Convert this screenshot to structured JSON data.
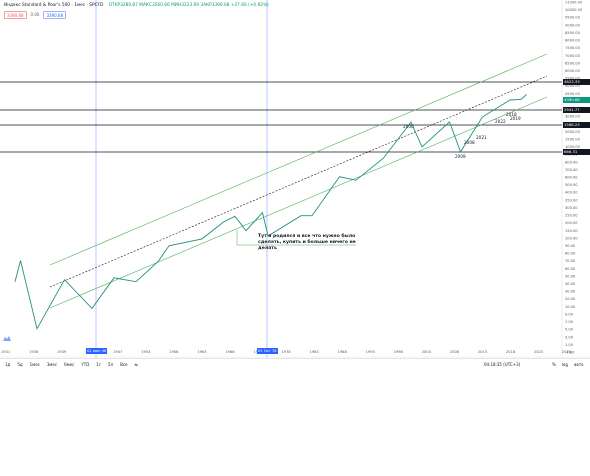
{
  "legend": {
    "title": "Индекс Standard & Poor's 500 · 1мес · SPCFD",
    "ohlc": "OTKP3280.87 МАКС3560.66 МИН3223.69 ЗАКР3390.68 +27.66 (+0.82%)"
  },
  "price_buttons": {
    "sell": "3390.68",
    "mid": "0.00",
    "buy": "3390.68"
  },
  "y_axis": {
    "ticks": [
      "11000.00",
      "10000.00",
      "9500.00",
      "9000.00",
      "8500.00",
      "8000.00",
      "7500.00",
      "7000.00",
      "6500.00",
      "6000.00",
      "5500.00",
      "5000.00",
      "4500.00",
      "4000.00",
      "3500.00",
      "3000.00",
      "2500.00",
      "2000.00",
      "1500.00",
      "1000.00",
      "900.00",
      "800.00",
      "700.00",
      "600.00",
      "500.00",
      "400.00",
      "350.00",
      "300.00",
      "250.00",
      "200.00",
      "150.00",
      "100.00",
      "90.00",
      "80.00",
      "70.00",
      "60.00",
      "50.00",
      "40.00",
      "30.00",
      "20.00",
      "10.00",
      "9.00",
      "7.00",
      "5.00",
      "3.00",
      "1.00",
      "-1.00"
    ],
    "labels": [
      {
        "text": "4823.33",
        "color": "#131722"
      },
      {
        "text": "3390.68",
        "color": "#089981"
      },
      {
        "text": "2941.77",
        "color": "#131722"
      },
      {
        "text": "1568.23",
        "color": "#131722"
      },
      {
        "text": "666.31",
        "color": "#131722"
      }
    ]
  },
  "x_axis": {
    "ticks": [
      "1931",
      "1936",
      "1939",
      "1943",
      "1947",
      "1953",
      "1958",
      "1963",
      "1968",
      "1973",
      "1978",
      "1983",
      "1988",
      "1993",
      "1998",
      "2003",
      "2008",
      "2013",
      "2018",
      "2023",
      "2028"
    ],
    "markers": [
      {
        "text": "01 июн 46"
      },
      {
        "text": "01 Окт 78"
      }
    ]
  },
  "annotations": {
    "note": "Тут я родился и все что нужно было сделать, купить и больше ничего не делать",
    "years": [
      "2000",
      "2008",
      "2009",
      "2018",
      "2021",
      "2022",
      "2019"
    ]
  },
  "period_buttons": [
    "1д",
    "5д",
    "1мес",
    "3мес",
    "6мес",
    "YTD",
    "1г",
    "5л",
    "Все",
    "⇆"
  ],
  "clock": "04:18:35 (UTC+3)",
  "options": [
    "%",
    "log",
    "авто"
  ],
  "colors": {
    "up": "#089981",
    "down": "#ef5350",
    "channel": "#4caf50",
    "accent": "#2962ff",
    "hline": "#131722"
  },
  "chart_data": {
    "type": "line",
    "title": "Индекс Standard & Poor's 500",
    "xlabel": "",
    "ylabel": "",
    "log_scale": true,
    "x": [
      1928,
      1929,
      1932,
      1937,
      1942,
      1946,
      1950,
      1954,
      1956,
      1962,
      1966,
      1968,
      1970,
      1973,
      1974,
      1980,
      1982,
      1987,
      1990,
      1995,
      2000,
      2002,
      2007,
      2009,
      2013,
      2018,
      2020,
      2021
    ],
    "series": [
      {
        "values": [
          17,
          31,
          4.5,
          18,
          8,
          19,
          17,
          30,
          47,
          57,
          93,
          108,
          72,
          120,
          62,
          110,
          110,
          330,
          300,
          560,
          1550,
          770,
          1560,
          670,
          1800,
          2900,
          2950,
          3390
        ]
      }
    ],
    "hlines": [
      4823.33,
      3390.68,
      2941.77,
      1568.23,
      666.31
    ],
    "grid": false
  }
}
